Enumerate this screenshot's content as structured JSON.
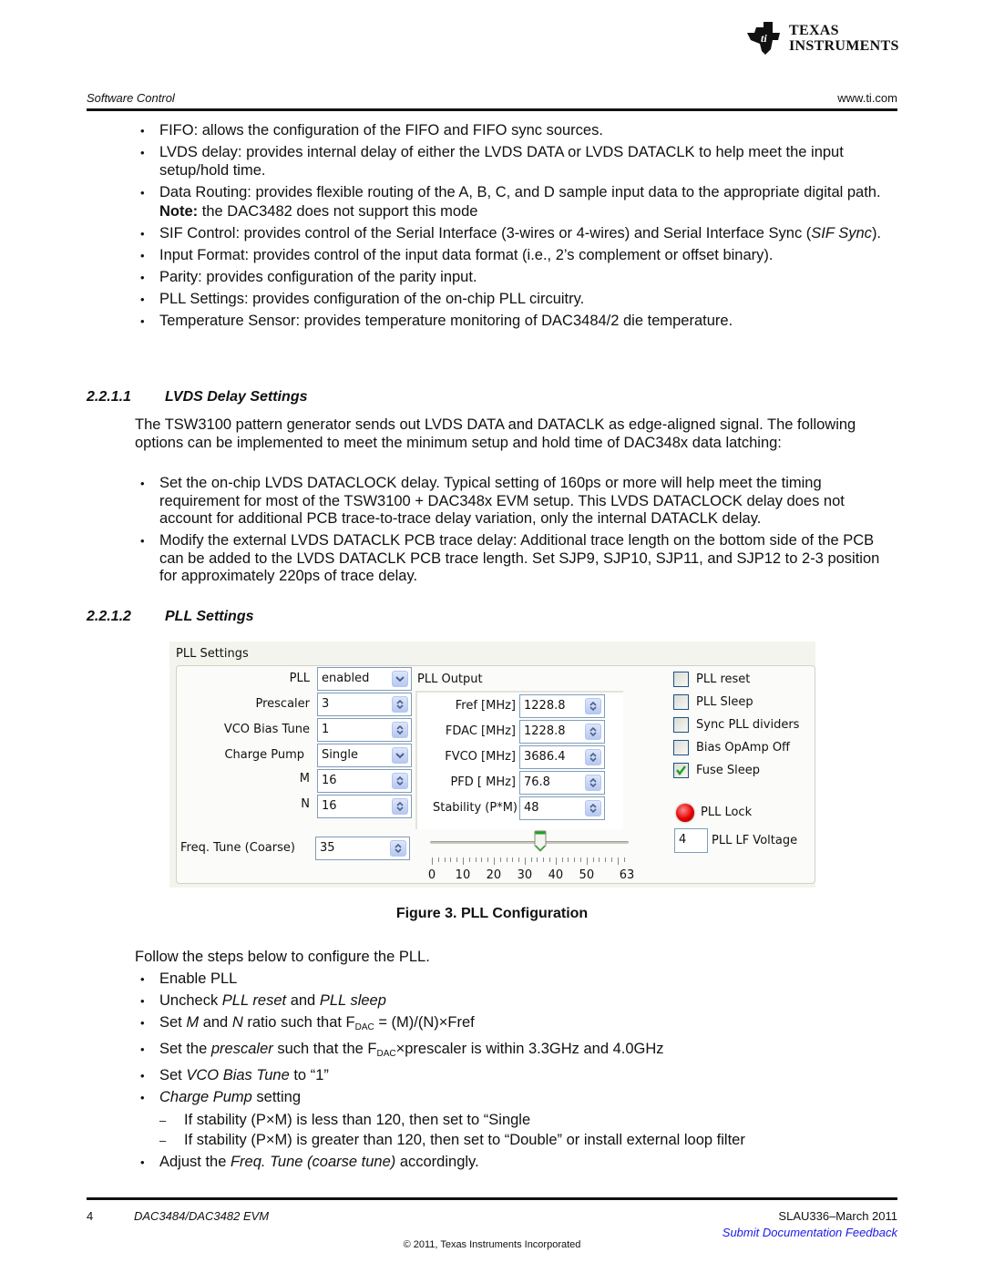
{
  "logo": {
    "line1": "Texas",
    "line2": "Instruments"
  },
  "header": {
    "section": "Software Control",
    "url": "www.ti.com"
  },
  "intro_bullets": [
    "FIFO: allows the configuration of the FIFO and FIFO sync sources.",
    "LVDS delay: provides internal delay of either the LVDS DATA or LVDS DATACLK to help meet the input setup/hold time.",
    "Data Routing: provides flexible routing of the A, B, C, and D sample input data to the appropriate digital path.",
    "SIF Control: provides control of the Serial Interface (3-wires or 4-wires) and Serial Interface Sync (",
    "Input Format: provides control of the input data format (i.e., 2’s complement or offset binary).",
    "Parity: provides configuration of the parity input.",
    "PLL Settings: provides configuration of the on-chip PLL circuitry.",
    "Temperature Sensor: provides temperature monitoring of DAC3484/2 die temperature."
  ],
  "sif_italic": "SIF Sync",
  "sif_close": ").",
  "note": {
    "bold": "Note:",
    "text": " the DAC3482 does not support this mode"
  },
  "section_lvds": {
    "number": "2.2.1.1",
    "title": "LVDS Delay Settings"
  },
  "lvds_para": "The TSW3100 pattern generator sends out LVDS DATA and DATACLK as edge-aligned signal. The following options can be implemented to meet the minimum setup and hold time of DAC348x data latching:",
  "lvds_bullets": [
    "Set the on-chip LVDS DATACLOCK delay. Typical setting of 160ps or more will help meet the timing requirement for most of the TSW3100 + DAC348x EVM setup. This LVDS DATACLOCK delay does not account for additional PCB trace-to-trace delay variation, only the internal DATACLK delay.",
    "Modify the external LVDS DATACLK PCB trace delay: Additional trace length on the bottom side of the PCB can be added to the LVDS DATACLK PCB trace length. Set SJP9, SJP10, SJP11, and SJP12 to 2-3 position for approximately 220ps of trace delay."
  ],
  "section_pll": {
    "number": "2.2.1.2",
    "title": "PLL Settings"
  },
  "pll_panel": {
    "title": "PLL Settings",
    "fields": [
      {
        "label": "PLL",
        "value": "enabled",
        "type": "dropdown"
      },
      {
        "label": "Prescaler",
        "value": "3",
        "type": "spinner"
      },
      {
        "label": "VCO Bias Tune",
        "value": "1",
        "type": "spinner"
      },
      {
        "label": "Charge Pump",
        "value": "Single",
        "type": "dropdown"
      },
      {
        "label": "M",
        "value": "16",
        "type": "spinner"
      },
      {
        "label": "N",
        "value": "16",
        "type": "spinner"
      }
    ],
    "freq_tune": {
      "label": "Freq. Tune (Coarse)",
      "value": "35"
    },
    "output": {
      "title": "PLL Output",
      "fields": [
        {
          "label": "Fref [MHz]",
          "value": "1228.8"
        },
        {
          "label": "FDAC [MHz]",
          "value": "1228.8"
        },
        {
          "label": "FVCO [MHz]",
          "value": "3686.4"
        },
        {
          "label": "PFD [ MHz]",
          "value": "76.8"
        },
        {
          "label": "Stability (P*M)",
          "value": "48"
        }
      ]
    },
    "slider": {
      "min": 0,
      "max": 63,
      "value": 35,
      "tick_labels": [
        "0",
        "10",
        "20",
        "30",
        "40",
        "50",
        "63"
      ]
    },
    "checkboxes": [
      {
        "label": "PLL reset",
        "checked": false
      },
      {
        "label": "PLL Sleep",
        "checked": false
      },
      {
        "label": "Sync PLL dividers",
        "checked": false
      },
      {
        "label": "Bias OpAmp Off",
        "checked": false
      },
      {
        "label": "Fuse Sleep",
        "checked": true
      }
    ],
    "lock": {
      "label": "PLL Lock",
      "color": "#e50000"
    },
    "lf_voltage": {
      "label": "PLL LF Voltage",
      "value": "4"
    }
  },
  "figure_caption": "Figure 3. PLL Configuration",
  "steps_intro": "Follow the steps below to configure the PLL.",
  "steps": {
    "s1": "Enable PLL",
    "s2a": "Uncheck ",
    "s2b": "PLL reset",
    "s2c": " and ",
    "s2d": "PLL sleep",
    "s3a": "Set ",
    "s3b": "M",
    "s3c": " and ",
    "s3d": "N",
    "s3e": " ratio such that F",
    "s3sub": "DAC",
    "s3f": " = (M)/(N)×Fref",
    "s4a": "Set the ",
    "s4b": "prescaler",
    "s4c": " such that the F",
    "s4sub": "DAC",
    "s4d": "×prescaler is within 3.3GHz and 4.0GHz",
    "s5a": "Set ",
    "s5b": "VCO Bias Tune",
    "s5c": " to “1”",
    "s6a": "Charge Pump",
    "s6b": " setting",
    "s6_sub": [
      "If stability (P×M) is less than 120, then set to “Single",
      "If stability (P×M) is greater than 120, then set to “Double” or install external loop filter"
    ],
    "s7a": "Adjust the ",
    "s7b": "Freq. Tune (coarse tune)",
    "s7c": " accordingly."
  },
  "footer": {
    "page": "4",
    "doc": "DAC3484/DAC3482 EVM",
    "rev": "SLAU336–March 2011",
    "feedback": "Submit Documentation Feedback",
    "copyright": "© 2011, Texas Instruments Incorporated"
  }
}
